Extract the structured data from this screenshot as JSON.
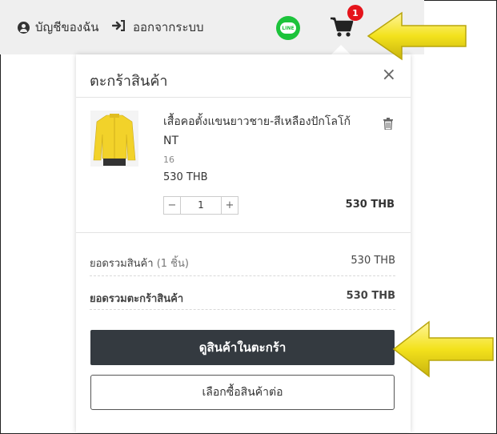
{
  "topbar": {
    "account_label": "บัญชีของฉัน",
    "logout_label": "ออกจากระบบ",
    "line_text": "LINE",
    "cart_count": "1"
  },
  "cart_panel": {
    "title": "ตะกร้าสินค้า",
    "close_glyph": "×",
    "item": {
      "name": "เสื้อคอตั้งแขนยาวชาย-สีเหลืองปักโลโก้ NT",
      "variant": "16",
      "price": "530 THB",
      "quantity": "1",
      "minus": "−",
      "plus": "+",
      "line_total": "530 THB"
    },
    "summary": {
      "subtotal_label": "ยอดรวมสินค้า",
      "subtotal_qty": "(1 ชิ้น)",
      "subtotal_value": "530 THB",
      "total_label": "ยอดรวมตะกร้าสินค้า",
      "total_value": "530 THB"
    },
    "view_cart_button": "ดูสินค้าในตะกร้า",
    "continue_button": "เลือกซื้อสินค้าต่อ"
  },
  "colors": {
    "arrow": "#f3e21c",
    "button_dark": "#343a40",
    "badge": "#e5141b",
    "line_green": "#1cc33b",
    "shirt": "#f2d22a"
  },
  "icons": [
    "user-icon",
    "logout-icon",
    "line-icon",
    "cart-icon",
    "close-icon",
    "trash-icon",
    "arrow-icon"
  ]
}
